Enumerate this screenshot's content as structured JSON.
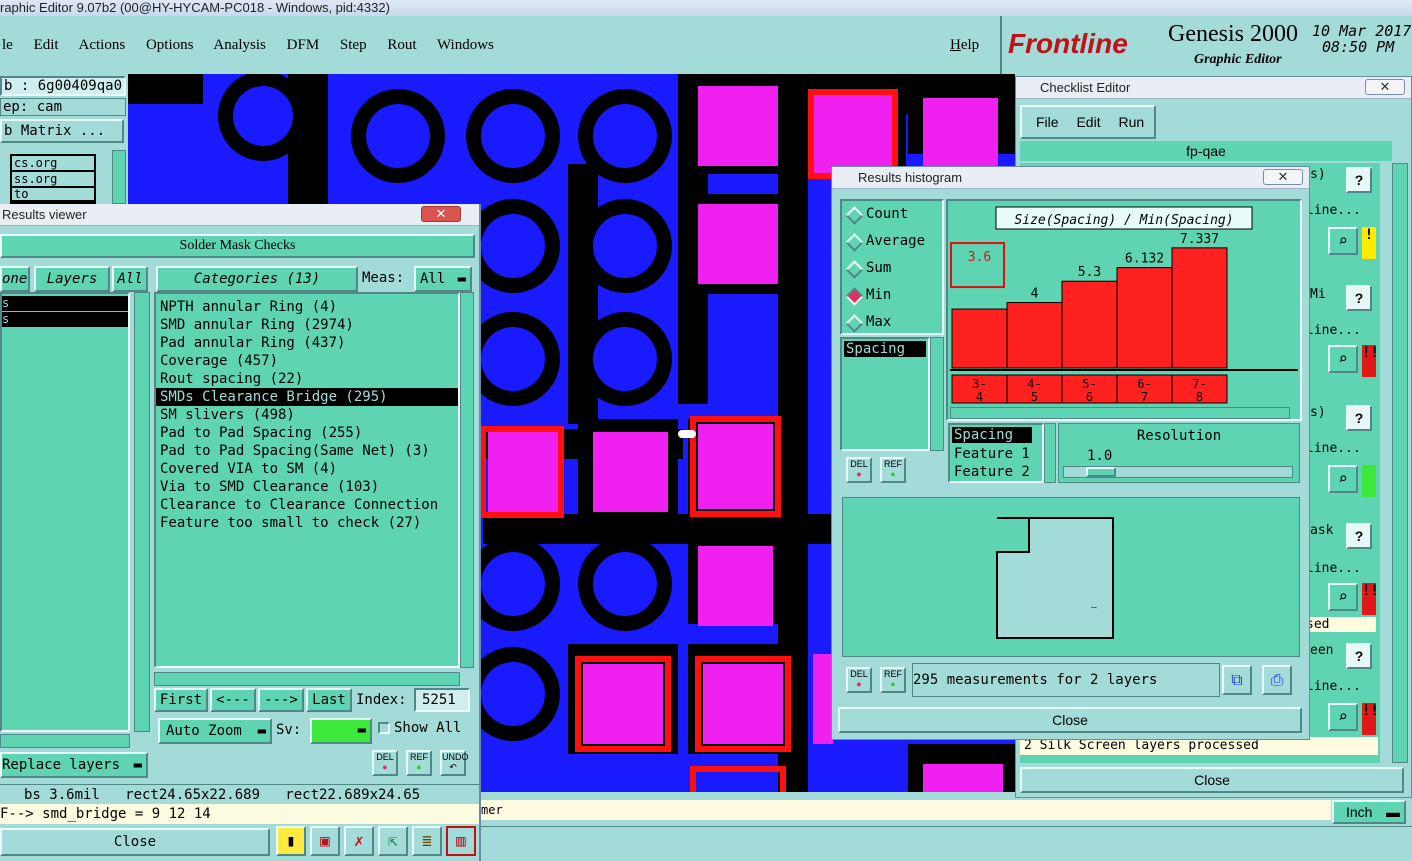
{
  "titlebar": {
    "text": "raphic Editor 9.07b2 (00@HY-HYCAM-PC018 - Windows, pid:4332)"
  },
  "menubar": {
    "items": [
      "le",
      "Edit",
      "Actions",
      "Options",
      "Analysis",
      "DFM",
      "Step",
      "Rout",
      "Windows"
    ],
    "help": "Help"
  },
  "brand": {
    "logo": "Frontline",
    "product": "Genesis 2000",
    "subtitle": "Graphic Editor",
    "date": "10 Mar 2017",
    "time": "08:50 PM"
  },
  "left_panel": {
    "job": "b : 6g00409qa0",
    "step": "ep: cam",
    "matrix": "b Matrix ...",
    "layers": [
      "cs.org",
      "ss.org",
      "to"
    ]
  },
  "results_viewer": {
    "title": "Results viewer",
    "header": "Solder Mask Checks",
    "tabs": {
      "none": "one",
      "layers": "Layers",
      "all": "All",
      "categories": "Categories (13)",
      "meas_label": "Meas:",
      "meas_value": "All"
    },
    "categories": [
      "NPTH annular Ring (4)",
      "SMD annular Ring (2974)",
      "Pad annular Ring (437)",
      "Coverage (457)",
      "Rout spacing (22)",
      "SMDs Clearance Bridge (295)",
      "SM slivers (498)",
      "Pad to Pad Spacing (255)",
      "Pad to Pad Spacing(Same Net) (3)",
      "Covered VIA to SM (4)",
      "Via to SMD Clearance (103)",
      "Clearance to Clearance Connection",
      "Feature too small to check (27)"
    ],
    "selected_index": 5,
    "nav": {
      "first": "First",
      "prev": "<---",
      "next": "--->",
      "last": "Last",
      "index_label": "Index:",
      "index_value": "5251"
    },
    "auto_zoom": "Auto Zoom",
    "sv_label": "Sv:",
    "show_all": "Show All",
    "replace_layers": "Replace layers",
    "tool_labels": {
      "del": "DEL",
      "ref": "REF",
      "undo": "UNDO"
    },
    "status1": "bs 3.6mil   rect24.65x22.689   rect22.689x24.65",
    "status2": "F--> smd_bridge = 9 12 14",
    "close": "Close"
  },
  "histogram": {
    "title": "Results histogram",
    "modes": [
      "Count",
      "Average",
      "Sum",
      "Min",
      "Max"
    ],
    "active_mode": "Min",
    "list_item": "Spacing",
    "chart_title": "Size(Spacing) / Min(Spacing)",
    "feature_list": [
      "Spacing",
      "Feature 1",
      "Feature 2"
    ],
    "resolution_label": "Resolution",
    "resolution_value": "1.0",
    "measurements": "295 measurements for 2 layers",
    "close": "Close",
    "tool_labels": {
      "del": "DEL",
      "ref": "REF"
    }
  },
  "chart_data": {
    "type": "bar",
    "title": "Size(Spacing) / Min(Spacing)",
    "categories": [
      "3-4",
      "4-5",
      "5-6",
      "6-7",
      "7-8"
    ],
    "category_tops": [
      "3-",
      "4-",
      "5-",
      "6-",
      "7-"
    ],
    "category_bottoms": [
      "4",
      "5",
      "6",
      "7",
      "8"
    ],
    "values": [
      3.6,
      4,
      5.3,
      6.132,
      7.337
    ],
    "value_labels": [
      "3.6",
      "4",
      "5.3",
      "6.132",
      "7.337"
    ],
    "highlighted": 0,
    "color": "#ff2020",
    "ylim": [
      0,
      8
    ]
  },
  "checklist": {
    "title": "Checklist Editor",
    "menu": [
      "File",
      "Edit",
      "Run"
    ],
    "name": "fp-qae",
    "row_fragments": [
      "s)",
      "line...",
      "Mi",
      "line...",
      "s)",
      "line...",
      "ask",
      "line...",
      "sed",
      "een",
      "line..."
    ],
    "status_msg": "2 Silk Screen layers processed",
    "close": "Close",
    "unit": "Inch"
  },
  "bottom": {
    "prompt": "mer"
  },
  "colors": {
    "bg": "#a3dbd9",
    "panel": "#5fd4b2",
    "pcb_blue": "#1a1aff",
    "pad_magenta": "#f020f0",
    "pad_red": "#ff1010",
    "bar_red": "#ff2020"
  }
}
